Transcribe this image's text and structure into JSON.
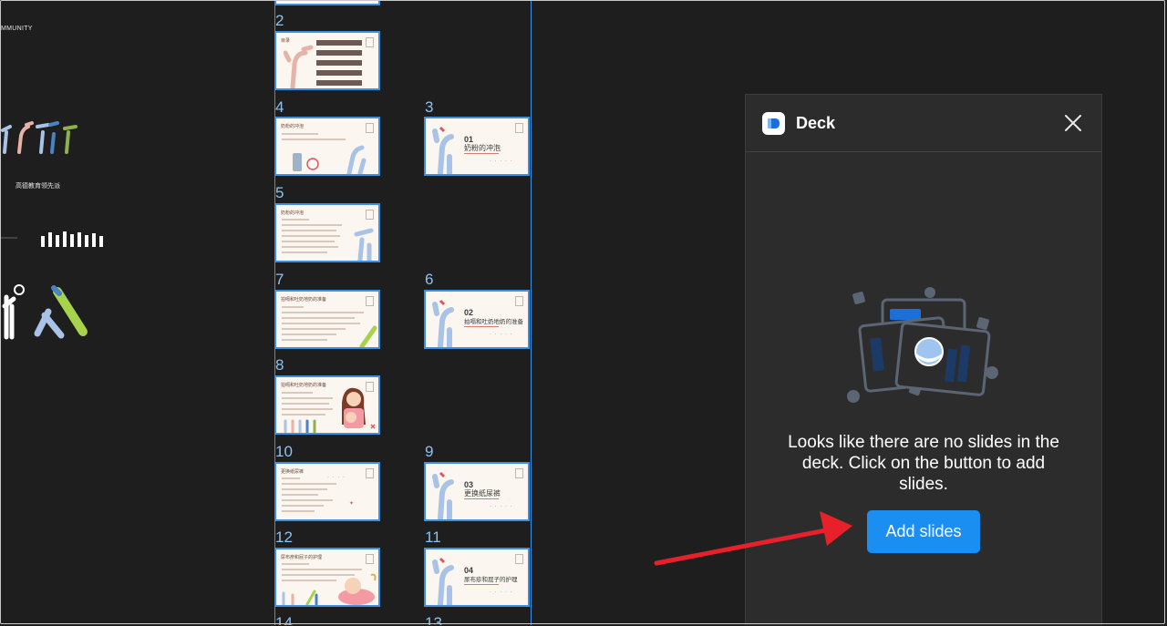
{
  "canvas": {
    "community_text": "MMUNITY",
    "edu_label": "高德教育领先派"
  },
  "slides": [
    {
      "number": "2",
      "title": "目录",
      "kind": "toc"
    },
    {
      "number": "4",
      "title": "奶粉的冲泡",
      "kind": "content"
    },
    {
      "number": "3",
      "section_no": "01",
      "section_title": "奶粉的冲泡",
      "kind": "section"
    },
    {
      "number": "5",
      "title": "奶粉的冲泡",
      "kind": "content"
    },
    {
      "number": "7",
      "title": "拍嗝和吐奶地奶的准备",
      "kind": "content"
    },
    {
      "number": "6",
      "section_no": "02",
      "section_title": "拍嗝和吐奶地奶的准备",
      "kind": "section"
    },
    {
      "number": "8",
      "title": "拍嗝和吐奶地奶的准备",
      "kind": "content"
    },
    {
      "number": "10",
      "title": "更换纸尿裤",
      "kind": "content"
    },
    {
      "number": "9",
      "section_no": "03",
      "section_title": "更换纸尿裤",
      "kind": "section"
    },
    {
      "number": "12",
      "title": "尿布疹和屁子的护理",
      "kind": "content"
    },
    {
      "number": "11",
      "section_no": "04",
      "section_title": "尿布疹和屁子的护理",
      "kind": "section"
    },
    {
      "number": "14",
      "kind": "cut"
    },
    {
      "number": "13",
      "kind": "cut"
    }
  ],
  "deck_panel": {
    "title": "Deck",
    "empty_message": "Looks like there are no slides in the deck. Click on the button to add slides.",
    "add_button_label": "Add slides"
  },
  "colors": {
    "accent": "#1b8ef2",
    "selection_blue": "#3d8fe0",
    "arrow_red": "#e8202a",
    "panel_bg": "#2c2c2c",
    "canvas_bg": "#1e1e1e"
  }
}
